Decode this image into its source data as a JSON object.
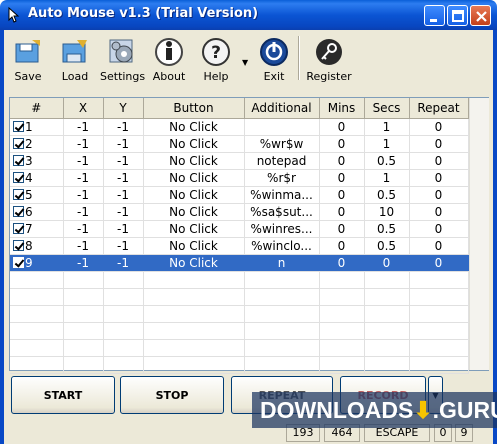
{
  "window": {
    "title": "Auto Mouse v1.3 (Trial Version)"
  },
  "toolbar": [
    {
      "label": "Save",
      "icon": "save-icon"
    },
    {
      "label": "Load",
      "icon": "load-icon"
    },
    {
      "label": "Settings",
      "icon": "settings-icon"
    },
    {
      "label": "About",
      "icon": "about-icon"
    },
    {
      "label": "Help",
      "icon": "help-icon"
    },
    {
      "label": "Exit",
      "icon": "exit-icon"
    },
    {
      "label": "Register",
      "icon": "register-icon"
    }
  ],
  "table": {
    "columns": [
      "#",
      "X",
      "Y",
      "Button",
      "Additional",
      "Mins",
      "Secs",
      "Repeat"
    ],
    "rows": [
      [
        "1",
        "-1",
        "-1",
        "No Click",
        "",
        "0",
        "1",
        "0"
      ],
      [
        "2",
        "-1",
        "-1",
        "No Click",
        "%wr$w",
        "0",
        "1",
        "0"
      ],
      [
        "3",
        "-1",
        "-1",
        "No Click",
        "notepad",
        "0",
        "0.5",
        "0"
      ],
      [
        "4",
        "-1",
        "-1",
        "No Click",
        "%r$r",
        "0",
        "1",
        "0"
      ],
      [
        "5",
        "-1",
        "-1",
        "No Click",
        "%winma...",
        "0",
        "0.5",
        "0"
      ],
      [
        "6",
        "-1",
        "-1",
        "No Click",
        "%sa$sut...",
        "0",
        "10",
        "0"
      ],
      [
        "7",
        "-1",
        "-1",
        "No Click",
        "%winres...",
        "0",
        "0.5",
        "0"
      ],
      [
        "8",
        "-1",
        "-1",
        "No Click",
        "%winclo...",
        "0",
        "0.5",
        "0"
      ],
      [
        "9",
        "-1",
        "-1",
        "No Click",
        "n",
        "0",
        "0",
        "0"
      ]
    ],
    "selected_row": 9
  },
  "buttons": {
    "start": "START",
    "stop": "STOP",
    "repeat": "REPEAT",
    "record": "RECORD"
  },
  "status": {
    "x": "193",
    "y": "464",
    "key": "ESCAPE",
    "a": "0",
    "b": "9"
  },
  "watermark": {
    "text": "DOWNLOADS",
    "dot": "⬇",
    "suffix": ".GURU"
  },
  "colors": {
    "titlebar": "#0a5fd8",
    "selection": "#316ac5",
    "face": "#ece9d8"
  }
}
